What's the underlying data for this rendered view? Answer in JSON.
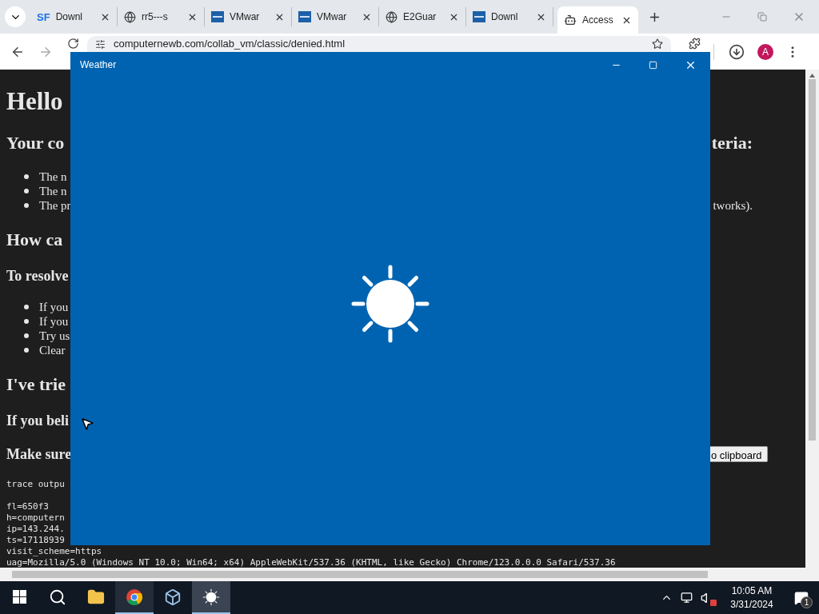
{
  "browser": {
    "tabs": [
      {
        "kind": "sf",
        "logo": "SF",
        "label": "Downl",
        "selected": false
      },
      {
        "kind": "globe",
        "label": "rr5---s",
        "selected": false
      },
      {
        "kind": "vmware",
        "label": "VMwar",
        "selected": false
      },
      {
        "kind": "vmware",
        "label": "VMwar",
        "selected": false
      },
      {
        "kind": "globe",
        "label": "E2Guar",
        "selected": false
      },
      {
        "kind": "vmware",
        "label": "Downl",
        "selected": false
      },
      {
        "kind": "robot",
        "label": "Access",
        "selected": true
      }
    ],
    "address": "computernewb.com/collab_vm/classic/denied.html",
    "avatar": "A"
  },
  "page": {
    "blocks": [
      {
        "kind": "h1",
        "text": "Hello"
      },
      {
        "kind": "h2",
        "text": "Your co",
        "right": "teria:"
      },
      {
        "kind": "li",
        "text": "The n"
      },
      {
        "kind": "li",
        "text": "The n"
      },
      {
        "kind": "li",
        "text": "The pr",
        "right": "tworks)."
      },
      {
        "kind": "h2",
        "text": "How ca"
      },
      {
        "kind": "h3",
        "text": "To resolve"
      },
      {
        "kind": "li",
        "text": "If you"
      },
      {
        "kind": "li",
        "text": "If you"
      },
      {
        "kind": "li",
        "text": "Try us"
      },
      {
        "kind": "li",
        "text": "Clear"
      },
      {
        "kind": "h2",
        "text": "I've trie"
      },
      {
        "kind": "h3",
        "text": "If you beli"
      },
      {
        "kind": "h3",
        "text": "Make sure",
        "button": "o clipboard"
      }
    ],
    "trace": {
      "heading": "trace outpu",
      "lines": [
        "fl=650f3",
        "h=computern",
        "ip=143.244.",
        "ts=17118939",
        "visit_scheme=https",
        "uag=Mozilla/5.0 (Windows NT 10.0; Win64; x64) AppleWebKit/537.36 (KHTML, like Gecko) Chrome/123.0.0.0 Safari/537.36"
      ]
    }
  },
  "weather_window": {
    "title": "Weather"
  },
  "taskbar": {
    "apps": [
      {
        "kind": "start",
        "running": false,
        "selected": false
      },
      {
        "kind": "search",
        "running": false,
        "selected": false
      },
      {
        "kind": "explorer",
        "running": false,
        "selected": false
      },
      {
        "kind": "chrome",
        "running": true,
        "selected": false
      },
      {
        "kind": "cube",
        "running": false,
        "selected": false
      },
      {
        "kind": "weather",
        "running": true,
        "selected": true
      }
    ],
    "time": "10:05 AM",
    "date": "3/31/2024",
    "notifications": "1"
  }
}
